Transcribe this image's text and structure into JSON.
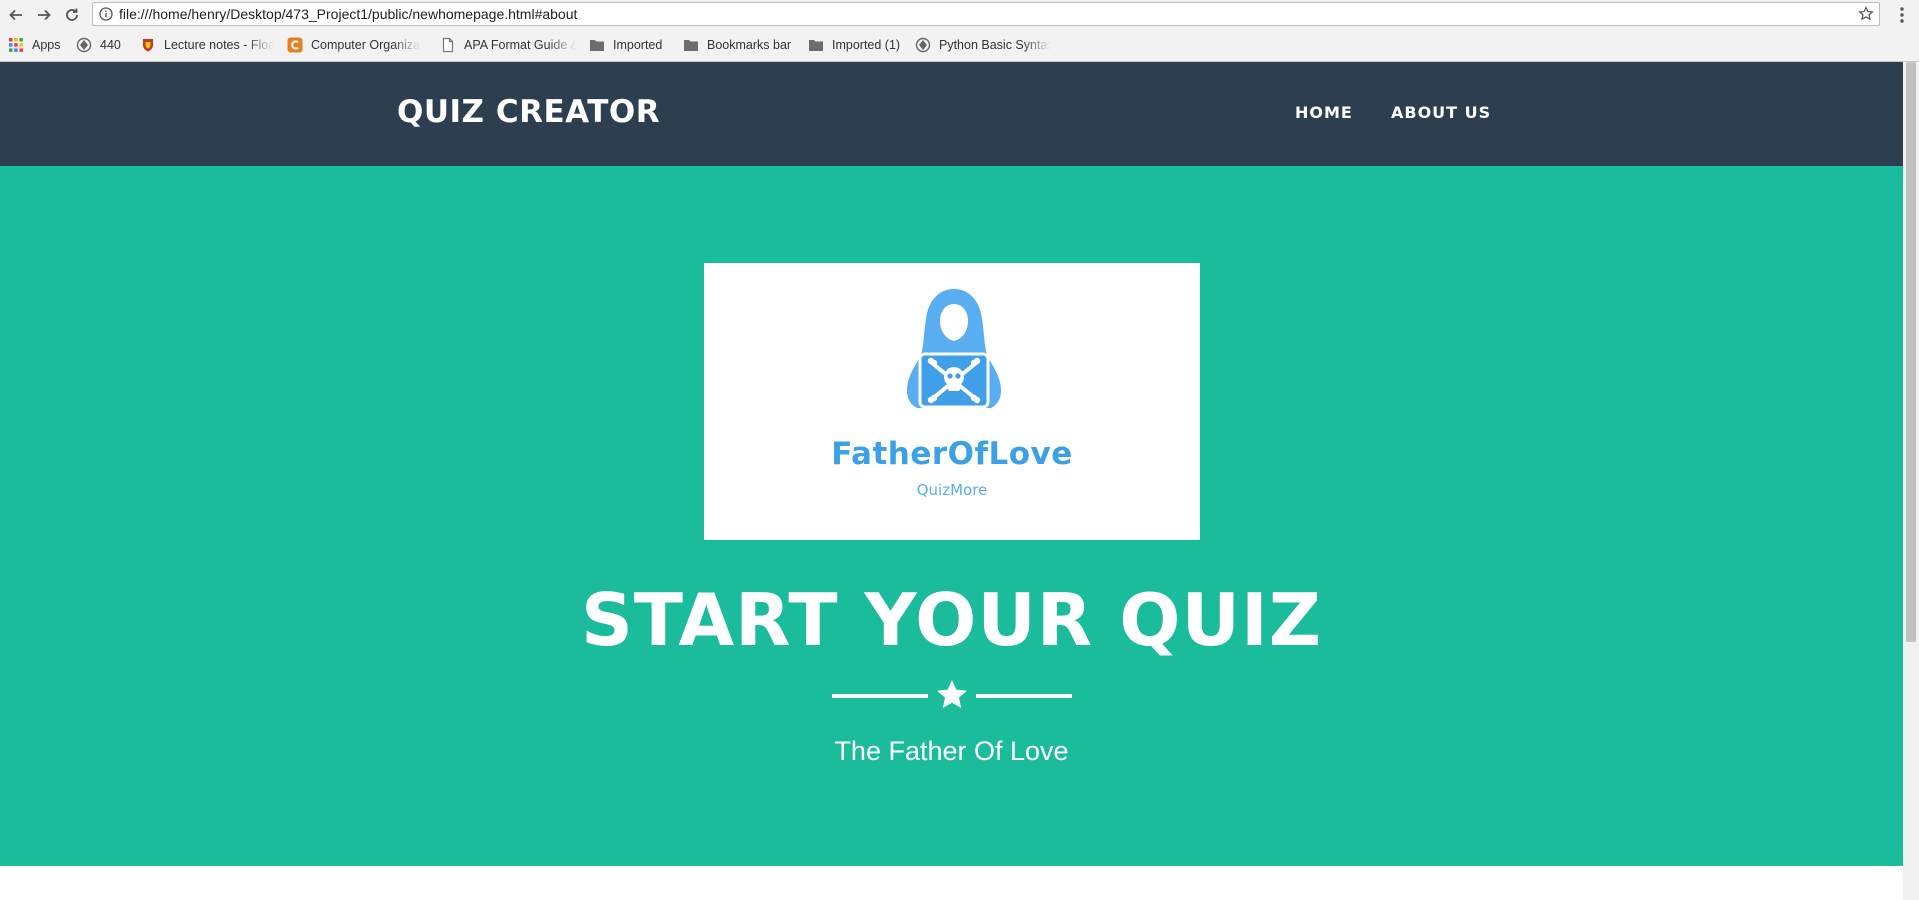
{
  "browser": {
    "url": "file:///home/henry/Desktop/473_Project1/public/newhomepage.html#about",
    "bookmarks": [
      {
        "label": "Apps",
        "icon": "apps-grid-icon"
      },
      {
        "label": "440",
        "icon": "site-icon"
      },
      {
        "label": "Lecture notes - Floa",
        "icon": "crest-icon"
      },
      {
        "label": "Computer Organiza",
        "icon": "c-logo-icon"
      },
      {
        "label": "APA Format Guide &",
        "icon": "page-icon"
      },
      {
        "label": "Imported",
        "icon": "folder-icon"
      },
      {
        "label": "Bookmarks bar",
        "icon": "folder-icon"
      },
      {
        "label": "Imported (1)",
        "icon": "folder-icon"
      },
      {
        "label": "Python Basic Syntax",
        "icon": "site-icon"
      }
    ]
  },
  "page": {
    "brand": "QUIZ CREATOR",
    "nav": [
      "HOME",
      "ABOUT US"
    ],
    "logo": {
      "title": "FatherOfLove",
      "subtitle": "QuizMore"
    },
    "headline": "START YOUR QUIZ",
    "tagline": "The Father Of Love",
    "colors": {
      "navbar": "#2c3e50",
      "masthead": "#1abc9c",
      "logo_blue": "#3ba0e6"
    }
  }
}
